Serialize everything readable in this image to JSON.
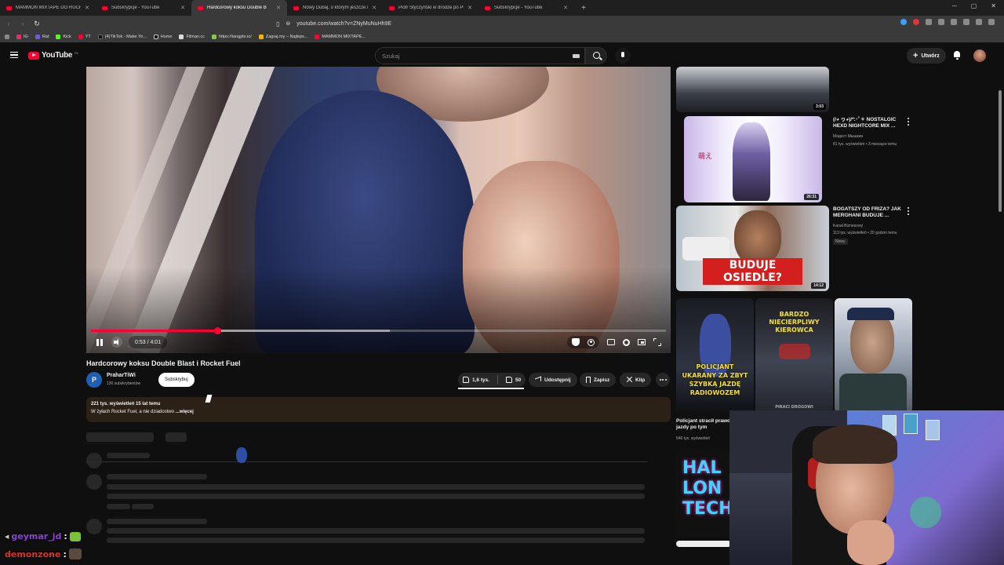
{
  "browser": {
    "tabs": [
      {
        "title": "MAMMON MIXTAPE DO RUCHO",
        "active": false
      },
      {
        "title": "Subskrypcje - YouTube",
        "active": false
      },
      {
        "title": "Hardcorowy koksu Double B",
        "active": true
      },
      {
        "title": "Nowy Dubaj, o którym jeszcze nie sł",
        "active": false
      },
      {
        "title": "Piotr Styczyński w drodze po Puchar",
        "active": false
      },
      {
        "title": "Subskrypcje - YouTube",
        "active": false
      }
    ],
    "new_tab": "+",
    "url": "youtube.com/watch?v=ZNyMuNuHh9E",
    "bookmarks": [
      "IG",
      "Rat",
      "Kick",
      "YT",
      "(4)TikTok - Make Yo...",
      "Home",
      "Filman.cc",
      "https://tangple.io/",
      "Zagraj.my – Najleps...",
      "MAMMON MIXTAPE..."
    ]
  },
  "masthead": {
    "logo_text": "YouTube",
    "region": "PL",
    "search_placeholder": "Szukaj",
    "create_label": "Utwórz"
  },
  "player": {
    "time_display": "0:53 / 4:01",
    "progress_fraction": 0.22
  },
  "video": {
    "title": "Hardcorowy koksu Double Blast i Rocket Fuel",
    "channel_initial": "P",
    "channel_name": "PraharTiWi",
    "subscribers": "130 subskrybentów",
    "subscribe_label": "Subskrybuj",
    "likes": "1,6 tys.",
    "dislikes": "50",
    "share_label": "Udostępnij",
    "save_label": "Zapisz",
    "clip_label": "Klip",
    "description_meta": "221 tys. wyświetleń  15 lat temu",
    "description_text": "W żyłach Rocket Fuel, a nie dziadostwo",
    "description_more": "...więcej"
  },
  "recommendations": [
    {
      "duration": "3:03"
    },
    {
      "title": "(/◕ ヮ◕)/*:･ﾟ✧ NOSTALGIC HEXD NIGHTCORE MIX ...",
      "channel": "Модест Мышкин",
      "meta": "81 tys. wyświetleń • 3 miesiące temu",
      "duration": "26:31",
      "thumb_text": "萌え"
    },
    {
      "title": "BOGATSZY OD FRIZA? JAK MERGHANI BUDUJE ...",
      "channel": "Kanał Biznesowy",
      "meta": "113 tys. wyświetleń • 20 godzin temu",
      "badge": "Nowy",
      "duration": "14:12",
      "thumb_text": "BUDUJE OSIEDLE?"
    },
    {
      "title": "Policjant stracił prawo jazdy po tym",
      "meta": "546 tys. wyświetleń",
      "thumb_text_a": "POLICJANT UKARANY ZA ZBYT SZYBKĄ JAZDĘ RADIOWOZEM",
      "thumb_text_b": "BARDZO NIECIERPLIWY KIEROWCA",
      "thumb_text_c": "PIRACI DROGOWI"
    },
    {
      "thumb_text": "HAL LON TECH"
    }
  ],
  "chat": [
    {
      "user": "geymar_jd",
      "color": "#8b45d6"
    },
    {
      "user": "demonzone",
      "color": "#d9332b"
    }
  ],
  "chat_separator": ":"
}
